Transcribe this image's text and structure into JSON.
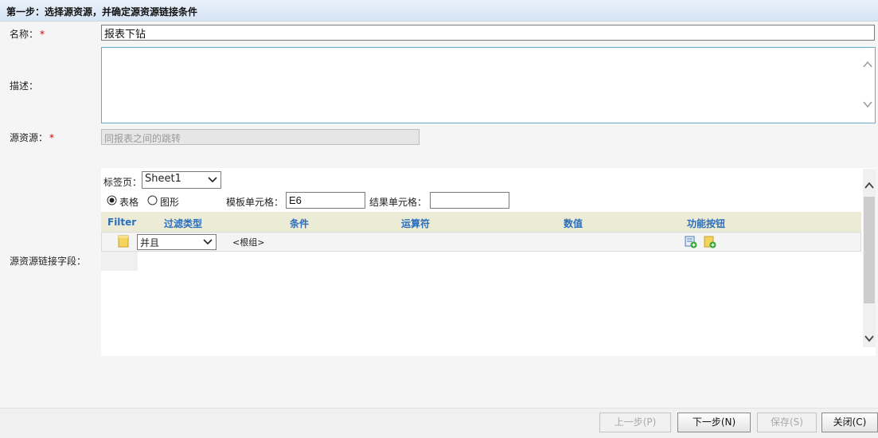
{
  "header": {
    "title": "第一步：选择源资源，并确定源资源链接条件"
  },
  "form": {
    "name_label": "名称：",
    "name_required": "*",
    "name_value": "报表下钻",
    "desc_label": "描述：",
    "desc_value": "",
    "source_label": "源资源：",
    "source_required": "*",
    "source_value": "同报表之间的跳转",
    "link_fields_label": "源资源链接字段："
  },
  "link_panel": {
    "tab_label": "标签页：",
    "tab_selected": "Sheet1",
    "radio_table_label": "表格",
    "radio_chart_label": "图形",
    "radio_selected": "表格",
    "template_cell_label": "模板单元格：",
    "template_cell_value": "E6",
    "result_cell_label": "结果单元格：",
    "result_cell_value": ""
  },
  "filter_table": {
    "headers": [
      "Filter",
      "过滤类型",
      "条件",
      "运算符",
      "数值",
      "功能按钮"
    ],
    "rows": [
      {
        "filter_type": "并且",
        "condition": "<根组>"
      }
    ]
  },
  "footer": {
    "prev_label": "上一步(P)",
    "next_label": "下一步(N)",
    "save_label": "保存(S)",
    "close_label": "关闭(C)"
  },
  "colors": {
    "header_text": "#2a6ebd",
    "table_header_bg": "#ecebd6",
    "required": "#d00000"
  }
}
